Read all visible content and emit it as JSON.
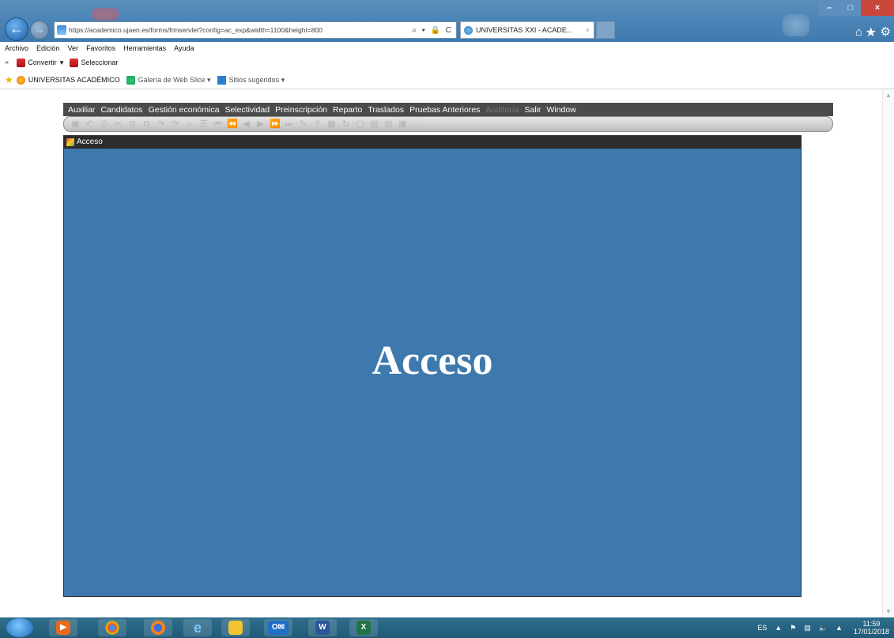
{
  "browser": {
    "address_url": "https://academico.ujaen.es/forms/frmservlet?config=ac_exp&width=1100&height=800",
    "address_controls": "⌕ ▾ 🔒 C",
    "tab_title": "UNIVERSITAS XXI - ACADE...",
    "tab_close": "×",
    "window_controls": {
      "minimize": "–",
      "maximize": "□",
      "close": "×"
    },
    "menu": [
      "Archivo",
      "Edición",
      "Ver",
      "Favoritos",
      "Herramientas",
      "Ayuda"
    ],
    "commandbar": {
      "close": "×",
      "convert": "Convertir",
      "convert_arrow": "▾",
      "select": "Seleccionar"
    },
    "favorites": [
      {
        "label": "UNIVERSITAS ACADÉMICO"
      },
      {
        "label": "Galería de Web Slice ▾"
      },
      {
        "label": "Sitios sugeridos ▾"
      }
    ]
  },
  "forms_menu": [
    {
      "label": "Auxiliar",
      "enabled": true
    },
    {
      "label": "Candidatos",
      "enabled": true
    },
    {
      "label": "Gestión económica",
      "enabled": true
    },
    {
      "label": "Selectividad",
      "enabled": true
    },
    {
      "label": "Preinscripción",
      "enabled": true
    },
    {
      "label": "Reparto",
      "enabled": true
    },
    {
      "label": "Traslados",
      "enabled": true
    },
    {
      "label": "Pruebas Anteriores",
      "enabled": true
    },
    {
      "label": "Auditoría",
      "enabled": false
    },
    {
      "label": "Salir",
      "enabled": true
    },
    {
      "label": "Window",
      "enabled": true
    }
  ],
  "acceso_window": {
    "title": "Acceso",
    "heading": "Acceso"
  },
  "taskbar": {
    "lang": "ES",
    "time": "11:59",
    "date": "17/01/2018"
  }
}
